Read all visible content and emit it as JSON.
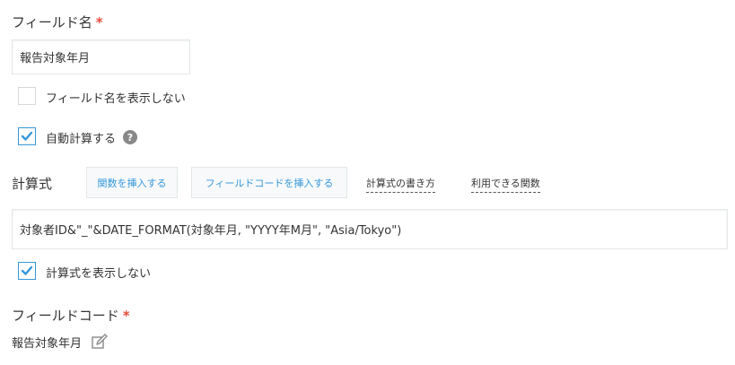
{
  "field_name": {
    "label": "フィールド名",
    "required_mark": "*",
    "value": "報告対象年月"
  },
  "hide_field_name": {
    "label": "フィールド名を表示しない",
    "checked": false
  },
  "auto_calculate": {
    "label": "自動計算する",
    "checked": true,
    "help_icon": "?"
  },
  "formula": {
    "label": "計算式",
    "insert_function_button": "関数を挿入する",
    "insert_field_code_button": "フィールドコードを挿入する",
    "how_to_write_link": "計算式の書き方",
    "available_functions_link": "利用できる関数",
    "value": "対象者ID&\"_\"&DATE_FORMAT(対象年月, \"YYYY年M月\", \"Asia/Tokyo\")"
  },
  "hide_formula": {
    "label": "計算式を表示しない",
    "checked": true
  },
  "field_code": {
    "label": "フィールドコード",
    "required_mark": "*",
    "value": "報告対象年月",
    "edit_icon": "pencil-icon"
  },
  "colors": {
    "accent": "#3498db",
    "required": "#e74c3c"
  }
}
